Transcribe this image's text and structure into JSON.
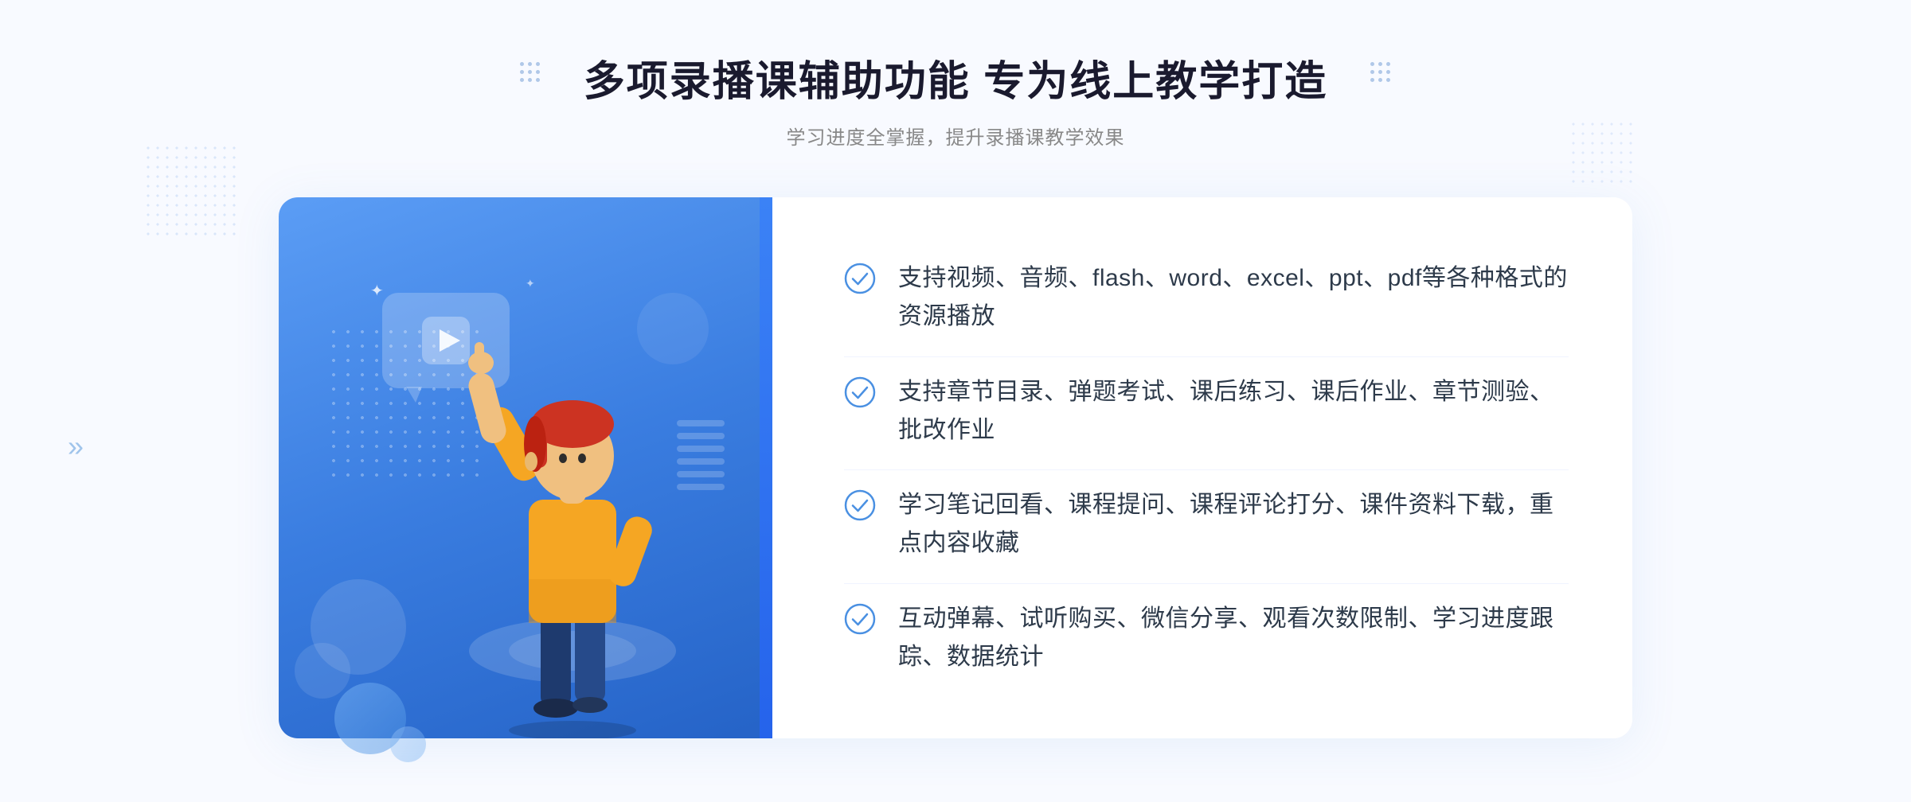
{
  "header": {
    "title": "多项录播课辅助功能 专为线上教学打造",
    "subtitle": "学习进度全掌握，提升录播课教学效果",
    "dots_left_label": "decorative dots left",
    "dots_right_label": "decorative dots right"
  },
  "features": [
    {
      "id": 1,
      "text": "支持视频、音频、flash、word、excel、ppt、pdf等各种格式的资源播放",
      "check_aria": "check icon 1"
    },
    {
      "id": 2,
      "text": "支持章节目录、弹题考试、课后练习、课后作业、章节测验、批改作业",
      "check_aria": "check icon 2"
    },
    {
      "id": 3,
      "text": "学习笔记回看、课程提问、课程评论打分、课件资料下载，重点内容收藏",
      "check_aria": "check icon 3"
    },
    {
      "id": 4,
      "text": "互动弹幕、试听购买、微信分享、观看次数限制、学习进度跟踪、数据统计",
      "check_aria": "check icon 4"
    }
  ],
  "illustration": {
    "play_button_aria": "play button illustration",
    "human_figure_aria": "person pointing up illustration"
  },
  "colors": {
    "blue_primary": "#3b82f6",
    "blue_gradient_start": "#5b9df5",
    "blue_gradient_end": "#2563c7",
    "text_dark": "#1a1a2e",
    "text_light": "#888888",
    "text_feature": "#2d3a4a",
    "check_blue": "#4a90e2"
  }
}
